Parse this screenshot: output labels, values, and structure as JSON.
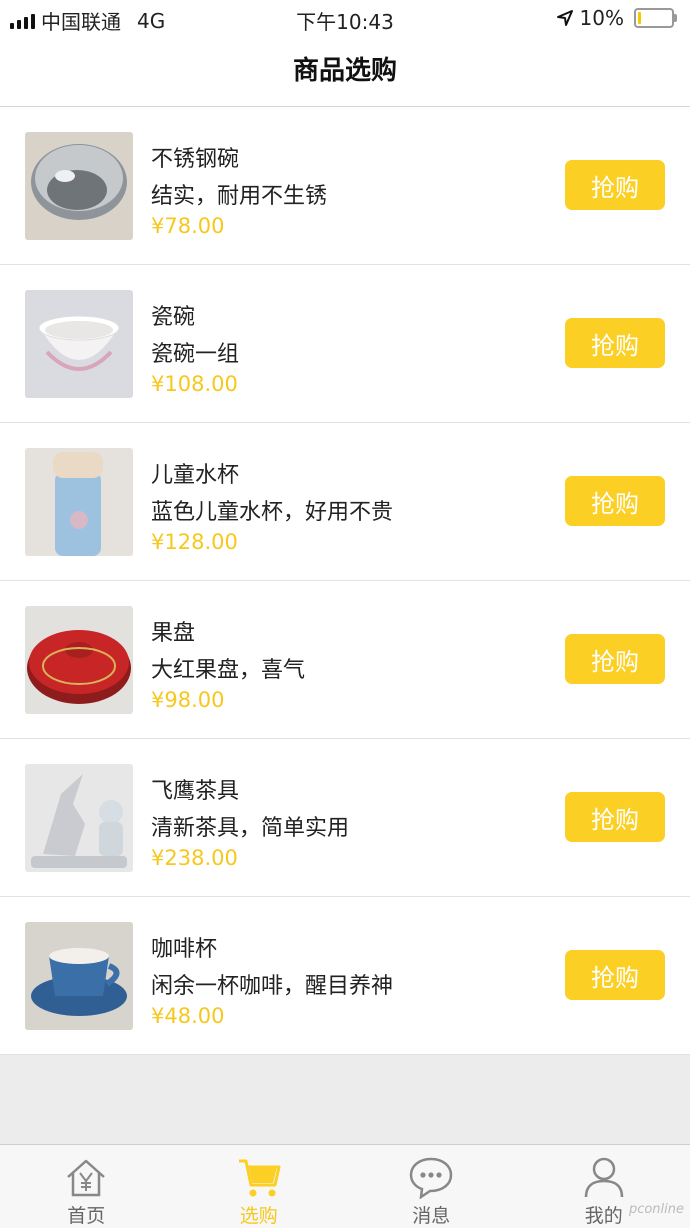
{
  "status_bar": {
    "carrier": "中国联通",
    "network": "4G",
    "time": "下午10:43",
    "battery": "10%",
    "battery_level": 0.1
  },
  "nav": {
    "title": "商品选购"
  },
  "products": [
    {
      "name": "不锈钢碗",
      "desc": "结实，耐用不生锈",
      "price": "¥78.00",
      "button": "抢购",
      "image": "steel-bowl"
    },
    {
      "name": "瓷碗",
      "desc": "瓷碗一组",
      "price": "¥108.00",
      "button": "抢购",
      "image": "porcelain-bowls"
    },
    {
      "name": "儿童水杯",
      "desc": "蓝色儿童水杯，好用不贵",
      "price": "¥128.00",
      "button": "抢购",
      "image": "kids-cup"
    },
    {
      "name": "果盘",
      "desc": "大红果盘，喜气",
      "price": "¥98.00",
      "button": "抢购",
      "image": "fruit-tray"
    },
    {
      "name": "飞鹰茶具",
      "desc": "清新茶具，简单实用",
      "price": "¥238.00",
      "button": "抢购",
      "image": "eagle-tea-set"
    },
    {
      "name": "咖啡杯",
      "desc": "闲余一杯咖啡，醒目养神",
      "price": "¥48.00",
      "button": "抢购",
      "image": "coffee-cup"
    }
  ],
  "tabs": [
    {
      "label": "首页",
      "icon": "home-icon",
      "active": false
    },
    {
      "label": "选购",
      "icon": "cart-icon",
      "active": true
    },
    {
      "label": "消息",
      "icon": "message-icon",
      "active": false
    },
    {
      "label": "我的",
      "icon": "user-icon",
      "active": false
    }
  ],
  "colors": {
    "accent": "#fccf24",
    "price": "#f6c81d",
    "inactive": "#666666"
  }
}
